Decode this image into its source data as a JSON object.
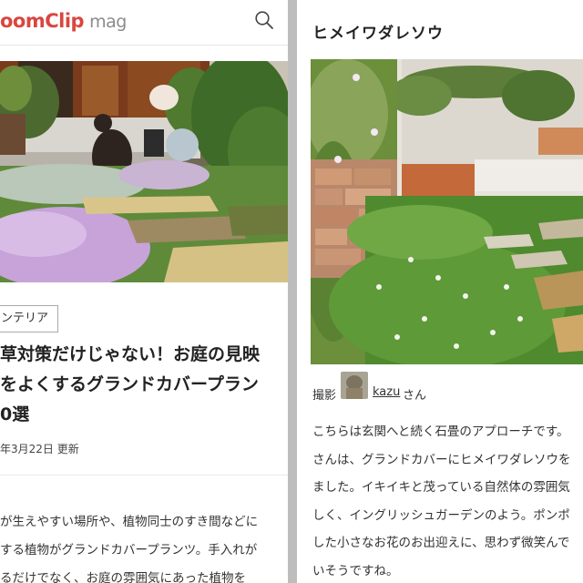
{
  "left": {
    "logo_main": "oomClip",
    "logo_sub": "mag",
    "category": "ンテリア",
    "title_lines": [
      "草対策だけじゃない！お庭の見映",
      "をよくするグランドカバープラン",
      "0選"
    ],
    "date": "年3月22日 更新",
    "body_lines": [
      "が生えやすい場所や、植物同士のすき間などに",
      "する植物がグランドカバープランツ。手入れが",
      "るだけでなく、お庭の雰囲気にあった植物を"
    ]
  },
  "right": {
    "heading": "ヒメイワダレソウ",
    "credit_label": "撮影",
    "credit_user": "kazu",
    "credit_suffix": "さん",
    "body_lines": [
      "こちらは玄関へと続く石畳のアプローチです。",
      "さんは、グランドカバーにヒメイワダレソウを",
      "ました。イキイキと茂っている自然体の雰囲気",
      "しく、イングリッシュガーデンのよう。ポンポ",
      "した小さなお花のお出迎えに、思わず微笑んで",
      "いそうですね。"
    ]
  },
  "colors": {
    "logo_red": "#d9463f",
    "logo_gray": "#8c8c8c",
    "divider_gray": "#bdbdbd"
  },
  "icons": [
    "search-icon",
    "avatar"
  ]
}
